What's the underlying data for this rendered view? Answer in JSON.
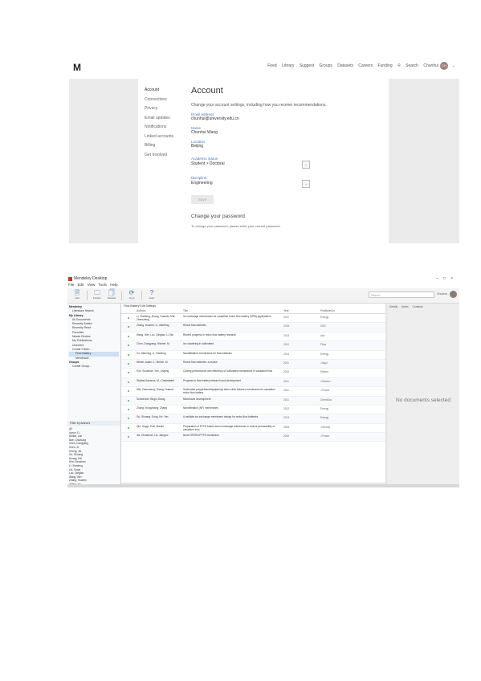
{
  "web": {
    "logo": "M",
    "nav": [
      "Feed",
      "Library",
      "Suggest",
      "Groups",
      "Datasets",
      "Careers",
      "Funding"
    ],
    "search_label": "Search",
    "user_name": "Chunhui",
    "user_initials": "CH",
    "sidebar": [
      "Account",
      "Connections",
      "Privacy",
      "Email updates",
      "Notifications",
      "Linked accounts",
      "Billing",
      "Get Involved"
    ],
    "title": "Account",
    "lead": "Change your account settings, including how you receive recommendations.",
    "email_label": "Email address",
    "email_value": "chunhui@university.edu.cn",
    "name_label": "Name",
    "name_value": "Chunhui Wang",
    "location_label": "Location",
    "location_value": "Beijing",
    "academic_label": "Academic status",
    "academic_value": "Student > Doctoral",
    "discipline_label": "Discipline",
    "discipline_value": "Engineering",
    "save_label": "Save",
    "password_title": "Change your password",
    "password_hint": "To change your password, please enter your current password."
  },
  "desktop": {
    "title": "Mendeley Desktop",
    "menu": [
      "File",
      "Edit",
      "View",
      "Tools",
      "Help"
    ],
    "toolbar": [
      "Add",
      "Folders",
      "Related",
      "Sync",
      "Help"
    ],
    "search_placeholder": "Search...",
    "user_name": "Chunhui",
    "tree": [
      {
        "label": "Mendeley",
        "level": 0,
        "header": true
      },
      {
        "label": "Literature Search",
        "level": 1
      },
      {
        "label": "My Library",
        "level": 0,
        "header": true
      },
      {
        "label": "All Documents",
        "level": 1
      },
      {
        "label": "Recently Added",
        "level": 1
      },
      {
        "label": "Recently Read",
        "level": 1
      },
      {
        "label": "Favorites",
        "level": 1
      },
      {
        "label": "Needs Review",
        "level": 1
      },
      {
        "label": "My Publications",
        "level": 1
      },
      {
        "label": "Unsorted",
        "level": 1
      },
      {
        "label": "Create Folder...",
        "level": 1
      },
      {
        "label": "Flow Battery",
        "level": 2,
        "selected": true
      },
      {
        "label": "Membrane",
        "level": 2
      },
      {
        "label": "Groups",
        "level": 0,
        "header": true
      },
      {
        "label": "Create Group...",
        "level": 1
      }
    ],
    "filter_label": "Filter by Authors",
    "authors": [
      "All",
      "Aaron, D.",
      "Akhtar, Lan",
      "Bae, Chulsung",
      "Chen, Dongyang",
      "Chen, Xi",
      "Cheng, Jie",
      "Gu, Shuang",
      "Huang, Kai",
      "Kim, Soowhan",
      "Li, Xianfeng",
      "Liu, Suqin",
      "Luo, Qingtao",
      "Wang, Wei",
      "Zhang, Huamin",
      "Zhang, Yu"
    ],
    "breadcrumb": "Flow Battery  Edit Settings",
    "columns": [
      "Authors",
      "Title",
      "Year",
      "Published In",
      "Added"
    ],
    "rows": [
      {
        "author": "Li, Xianfeng; Zhang, Huamin; Mai, Zhensheng",
        "title": "Ion exchange membranes for vanadium redox flow battery (VRB) applications",
        "year": "2011",
        "pub": "Energy"
      },
      {
        "author": "Zhang, Huamin; Li, Xianfeng",
        "title": "Redox flow batteries",
        "year": "2015",
        "pub": "CRC"
      },
      {
        "author": "Wang, Wei; Luo, Qingtao; Li, Bin",
        "title": "Recent progress in redox flow battery research",
        "year": "2013",
        "pub": "Adv"
      },
      {
        "author": "Chen, Dongyang; Hickner, M.",
        "title": "Ion clustering in sulfonated",
        "year": "2012",
        "pub": "Phys"
      },
      {
        "author": "Xu, Wanxing; Li, Xianfeng",
        "title": "Nanofiltration membranes for flow batteries",
        "year": "2014",
        "pub": "Energy"
      },
      {
        "author": "Weber, Adam Z.; Mench, M.",
        "title": "Redox flow batteries: a review",
        "year": "2011",
        "pub": "J Appl"
      },
      {
        "author": "Kim, Soowhan; Yan, Jingling",
        "title": "Cycling performance and efficiency of sulfonated membranes in vanadium flow",
        "year": "2010",
        "pub": "Electro"
      },
      {
        "author": "Skyllas-Kazacos, M.; Chakrabarti",
        "title": "Progress in flow battery research and development",
        "year": "2011",
        "pub": "J Electro"
      },
      {
        "author": "Mai, Zhensheng; Zhang, Huamin",
        "title": "Sulfonated poly(tetramethydiphenyl ether ether ketone) membranes for vanadium redox flow battery",
        "year": "2011",
        "pub": "J Power"
      },
      {
        "author": "Schwenzer, Birgit; Zhang",
        "title": "Membrane development",
        "year": "2011",
        "pub": "ChemSus"
      },
      {
        "author": "Zhang, Hongzhang; Zhang",
        "title": "Nanofiltration (NF) membranes",
        "year": "2012",
        "pub": "Energy"
      },
      {
        "author": "Gu, Shuang; Gong, Ke; Yan",
        "title": "A multiple ion-exchange membrane design for redox flow batteries",
        "year": "2014",
        "pub": "Energy"
      },
      {
        "author": "Qiu, Jingyi; Zhai, Maolin",
        "title": "Preparation of ETFE-based anion exchange membrane to reduce permeability of vanadium ions",
        "year": "2009",
        "pub": "J Membr"
      },
      {
        "author": "Jia, Chuankun; Liu, Jianguo",
        "title": "Novel SPEEK/PTFE membrane",
        "year": "2010",
        "pub": "J Power"
      }
    ],
    "detail_tabs": [
      "Details",
      "Notes",
      "Contents"
    ],
    "no_selection": "No documents selected"
  }
}
